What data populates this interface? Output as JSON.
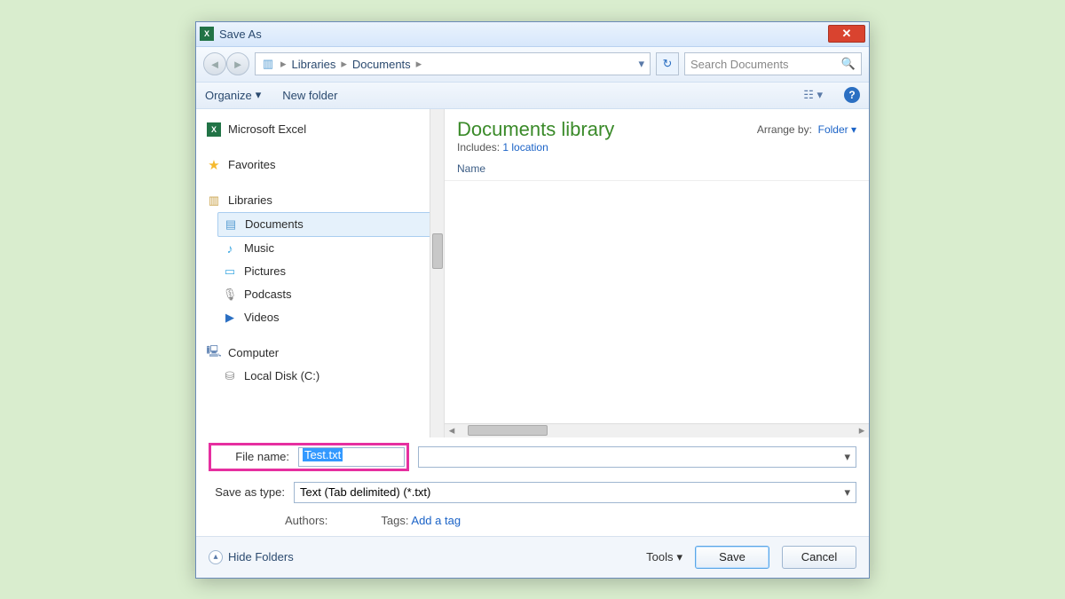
{
  "window": {
    "title": "Save As"
  },
  "breadcrumb": {
    "root": "Libraries",
    "current": "Documents"
  },
  "search": {
    "placeholder": "Search Documents"
  },
  "toolbar": {
    "organize": "Organize",
    "newfolder": "New folder"
  },
  "tree": {
    "excel": "Microsoft Excel",
    "favorites": "Favorites",
    "libraries": "Libraries",
    "documents": "Documents",
    "music": "Music",
    "pictures": "Pictures",
    "podcasts": "Podcasts",
    "videos": "Videos",
    "computer": "Computer",
    "localdisk": "Local Disk (C:)"
  },
  "library": {
    "title": "Documents library",
    "includes_label": "Includes:",
    "includes_link": "1 location",
    "arrange_label": "Arrange by:",
    "arrange_value": "Folder",
    "col_name": "Name"
  },
  "form": {
    "filename_label": "File name:",
    "filename_value": "Test.txt",
    "savetype_label": "Save as type:",
    "savetype_value": "Text (Tab delimited) (*.txt)",
    "authors_label": "Authors:",
    "tags_label": "Tags:",
    "tags_link": "Add a tag"
  },
  "footer": {
    "hide": "Hide Folders",
    "tools": "Tools",
    "save": "Save",
    "cancel": "Cancel"
  }
}
